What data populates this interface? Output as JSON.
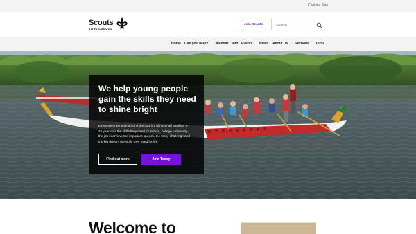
{
  "utility": {
    "cookies": "Cookies",
    "join": "Join"
  },
  "header": {
    "logo_text": "Scouts",
    "logo_subtitle": "1st Crowthorne",
    "join_button": "Join Scouts",
    "search_placeholder": "Search"
  },
  "nav": {
    "items": [
      {
        "label": "Home",
        "has_dropdown": false
      },
      {
        "label": "Can you help?",
        "has_dropdown": true
      },
      {
        "label": "Calendar",
        "has_dropdown": false
      },
      {
        "label": "Join",
        "has_dropdown": false
      },
      {
        "label": "Events",
        "has_dropdown": true
      },
      {
        "label": "News",
        "has_dropdown": false
      },
      {
        "label": "About Us",
        "has_dropdown": true
      },
      {
        "label": "Sections",
        "has_dropdown": true
      },
      {
        "label": "Tools",
        "has_dropdown": true
      }
    ]
  },
  "hero": {
    "headline": "We help young people gain the skills they need to shine bright",
    "body": "Every week we give around the country almost half a million 6-25 year olds the skills they need for school, college, university, the job interview, the important speech, the tricky challenge and the big dream: the skills they need for life.",
    "find_out_more": "Find out more",
    "join_today": "Join Today"
  },
  "welcome": {
    "heading": "Welcome to"
  },
  "colors": {
    "brand_purple": "#7413dc",
    "panel_black": "#000000",
    "nav_bg": "#f3f3f3"
  },
  "icons": {
    "logo": "fleur-de-lis-icon",
    "search": "search-icon",
    "dropdown": "chevron-down-icon"
  }
}
